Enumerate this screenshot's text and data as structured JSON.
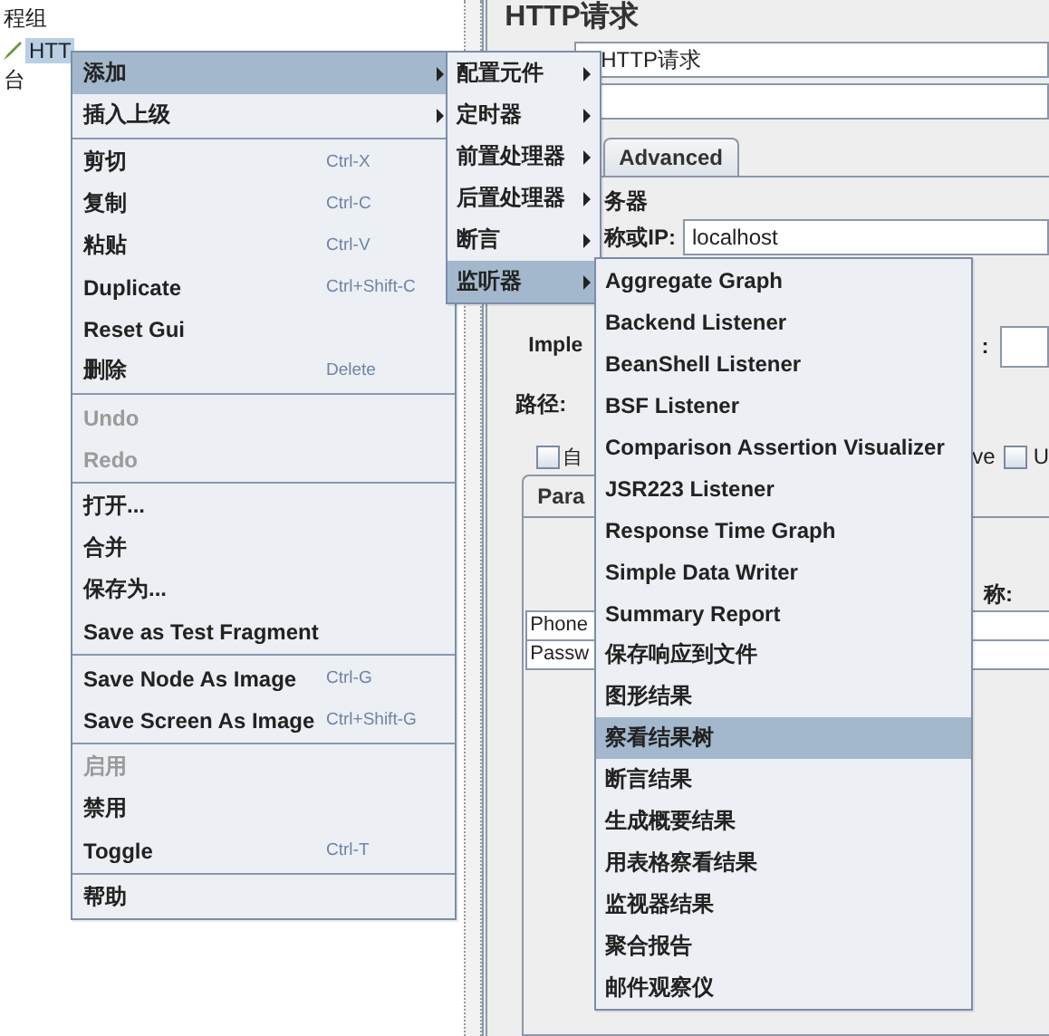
{
  "tree": {
    "items": [
      {
        "label": "程组",
        "selected": false,
        "children": [
          {
            "label": "HTT",
            "selected": true,
            "kind": "sampler"
          }
        ]
      },
      {
        "label": "台",
        "selected": false
      }
    ]
  },
  "panel": {
    "title": "HTTP请求",
    "name_value": "HTTP请求",
    "tabs": [
      {
        "label": "Advanced",
        "selected": false
      }
    ],
    "server": {
      "legend": "务器",
      "host_label": "称或IP:",
      "host_value": "localhost"
    },
    "impl_label": "Imple",
    "impl_colon": ":",
    "path_label": "路径:",
    "checkboxes": [
      {
        "label": "自",
        "checked": false
      },
      {
        "label": "U",
        "checked": false
      }
    ],
    "option_fragment": "ve",
    "param_tabs": [
      {
        "label": "Para",
        "selected": true
      }
    ],
    "param_table": {
      "header": "称:",
      "rows": [
        "Phone",
        "Passw"
      ]
    }
  },
  "context_menu": {
    "items": [
      {
        "kind": "item",
        "label": "添加",
        "submenu": true,
        "selected": true,
        "disabled": false
      },
      {
        "kind": "item",
        "label": "插入上级",
        "submenu": true,
        "selected": false,
        "disabled": false
      },
      {
        "kind": "separator"
      },
      {
        "kind": "item",
        "label": "剪切",
        "shortcut": "Ctrl-X",
        "selected": false,
        "disabled": false
      },
      {
        "kind": "item",
        "label": "复制",
        "shortcut": "Ctrl-C",
        "selected": false,
        "disabled": false
      },
      {
        "kind": "item",
        "label": "粘贴",
        "shortcut": "Ctrl-V",
        "selected": false,
        "disabled": false
      },
      {
        "kind": "item",
        "label": "Duplicate",
        "shortcut": "Ctrl+Shift-C",
        "selected": false,
        "disabled": false
      },
      {
        "kind": "item",
        "label": "Reset Gui",
        "selected": false,
        "disabled": false
      },
      {
        "kind": "item",
        "label": "删除",
        "shortcut": "Delete",
        "selected": false,
        "disabled": false
      },
      {
        "kind": "separator"
      },
      {
        "kind": "item",
        "label": "Undo",
        "selected": false,
        "disabled": true
      },
      {
        "kind": "item",
        "label": "Redo",
        "selected": false,
        "disabled": true
      },
      {
        "kind": "separator"
      },
      {
        "kind": "item",
        "label": "打开...",
        "selected": false,
        "disabled": false
      },
      {
        "kind": "item",
        "label": "合并",
        "selected": false,
        "disabled": false
      },
      {
        "kind": "item",
        "label": "保存为...",
        "selected": false,
        "disabled": false
      },
      {
        "kind": "item",
        "label": "Save as Test Fragment",
        "selected": false,
        "disabled": false
      },
      {
        "kind": "separator"
      },
      {
        "kind": "item",
        "label": "Save Node As Image",
        "shortcut": "Ctrl-G",
        "selected": false,
        "disabled": false
      },
      {
        "kind": "item",
        "label": "Save Screen As Image",
        "shortcut": "Ctrl+Shift-G",
        "selected": false,
        "disabled": false
      },
      {
        "kind": "separator"
      },
      {
        "kind": "item",
        "label": "启用",
        "selected": false,
        "disabled": true
      },
      {
        "kind": "item",
        "label": "禁用",
        "selected": false,
        "disabled": false
      },
      {
        "kind": "item",
        "label": "Toggle",
        "shortcut": "Ctrl-T",
        "selected": false,
        "disabled": false
      },
      {
        "kind": "separator"
      },
      {
        "kind": "item",
        "label": "帮助",
        "selected": false,
        "disabled": false
      }
    ]
  },
  "add_submenu": {
    "items": [
      {
        "kind": "item",
        "label": "配置元件",
        "submenu": true,
        "selected": false,
        "disabled": false
      },
      {
        "kind": "item",
        "label": "定时器",
        "submenu": true,
        "selected": false,
        "disabled": false
      },
      {
        "kind": "item",
        "label": "前置处理器",
        "submenu": true,
        "selected": false,
        "disabled": false
      },
      {
        "kind": "item",
        "label": "后置处理器",
        "submenu": true,
        "selected": false,
        "disabled": false
      },
      {
        "kind": "item",
        "label": "断言",
        "submenu": true,
        "selected": false,
        "disabled": false
      },
      {
        "kind": "item",
        "label": "监听器",
        "submenu": true,
        "selected": true,
        "disabled": false
      }
    ]
  },
  "listener_submenu": {
    "items": [
      {
        "kind": "item",
        "label": "Aggregate Graph",
        "selected": false,
        "disabled": false
      },
      {
        "kind": "item",
        "label": "Backend Listener",
        "selected": false,
        "disabled": false
      },
      {
        "kind": "item",
        "label": "BeanShell Listener",
        "selected": false,
        "disabled": false
      },
      {
        "kind": "item",
        "label": "BSF Listener",
        "selected": false,
        "disabled": false
      },
      {
        "kind": "item",
        "label": "Comparison Assertion Visualizer",
        "selected": false,
        "disabled": false
      },
      {
        "kind": "item",
        "label": "JSR223 Listener",
        "selected": false,
        "disabled": false
      },
      {
        "kind": "item",
        "label": "Response Time Graph",
        "selected": false,
        "disabled": false
      },
      {
        "kind": "item",
        "label": "Simple Data Writer",
        "selected": false,
        "disabled": false
      },
      {
        "kind": "item",
        "label": "Summary Report",
        "selected": false,
        "disabled": false
      },
      {
        "kind": "item",
        "label": "保存响应到文件",
        "selected": false,
        "disabled": false
      },
      {
        "kind": "item",
        "label": "图形结果",
        "selected": false,
        "disabled": false
      },
      {
        "kind": "item",
        "label": "察看结果树",
        "selected": true,
        "disabled": false
      },
      {
        "kind": "item",
        "label": "断言结果",
        "selected": false,
        "disabled": false
      },
      {
        "kind": "item",
        "label": "生成概要结果",
        "selected": false,
        "disabled": false
      },
      {
        "kind": "item",
        "label": "用表格察看结果",
        "selected": false,
        "disabled": false
      },
      {
        "kind": "item",
        "label": "监视器结果",
        "selected": false,
        "disabled": false
      },
      {
        "kind": "item",
        "label": "聚合报告",
        "selected": false,
        "disabled": false
      },
      {
        "kind": "item",
        "label": "邮件观察仪",
        "selected": false,
        "disabled": false
      }
    ]
  }
}
